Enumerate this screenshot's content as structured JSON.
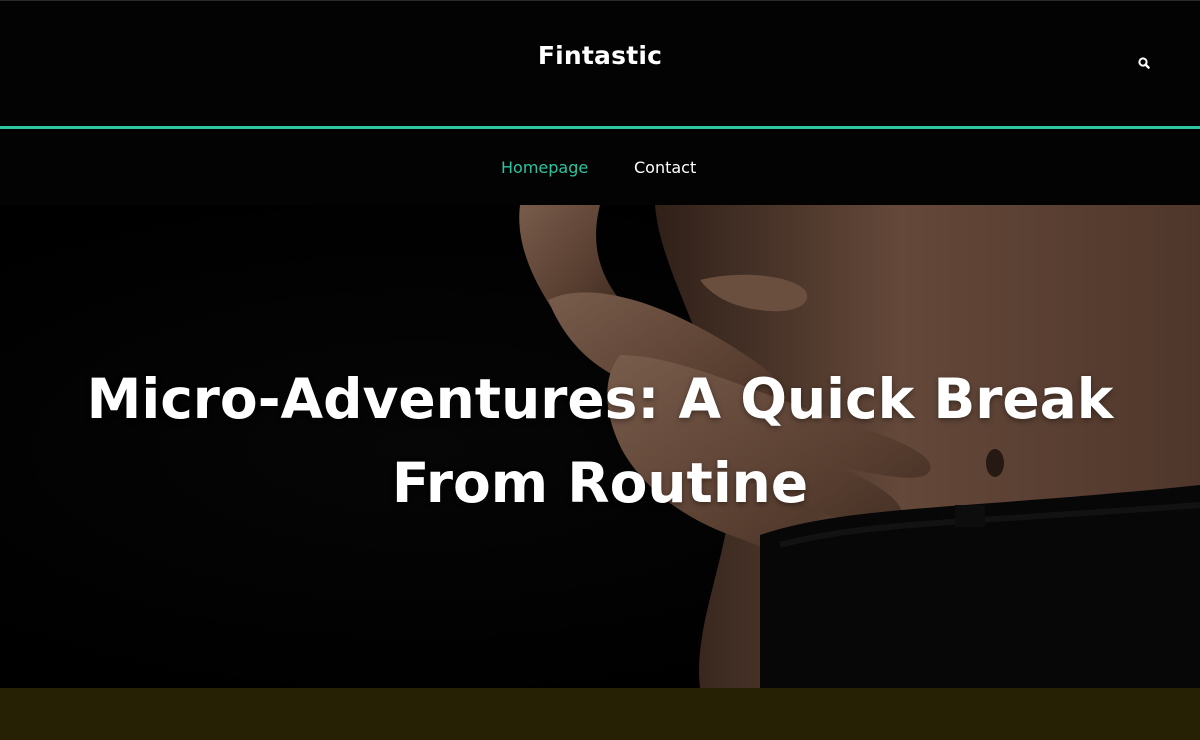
{
  "site": {
    "title": "Fintastic"
  },
  "header": {
    "search_icon": "search-icon"
  },
  "nav": {
    "items": [
      {
        "label": "Homepage",
        "active": true
      },
      {
        "label": "Contact",
        "active": false
      }
    ]
  },
  "hero": {
    "title": "Micro-Adventures: A Quick Break From Routine",
    "image": "hands-on-abdomen-photo"
  },
  "colors": {
    "accent": "#2ec4a0",
    "background": "#030303",
    "nav_text": "#ffffff",
    "bottom_band": "#262105"
  }
}
